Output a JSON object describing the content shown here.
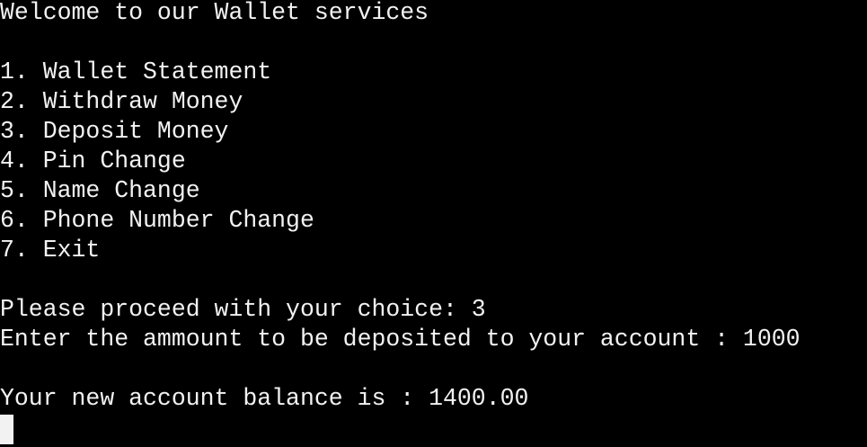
{
  "terminal": {
    "welcome": "Welcome to our Wallet services",
    "menu": [
      "1. Wallet Statement",
      "2. Withdraw Money",
      "3. Deposit Money",
      "4. Pin Change",
      "5. Name Change",
      "6. Phone Number Change",
      "7. Exit"
    ],
    "choice_prompt": "Please proceed with your choice: 3",
    "deposit_prompt": "Enter the ammount to be deposited to your account : 1000",
    "balance_message": "Your new account balance is : 1400.00"
  },
  "colors": {
    "background": "#000000",
    "text": "#f2f2f2"
  }
}
